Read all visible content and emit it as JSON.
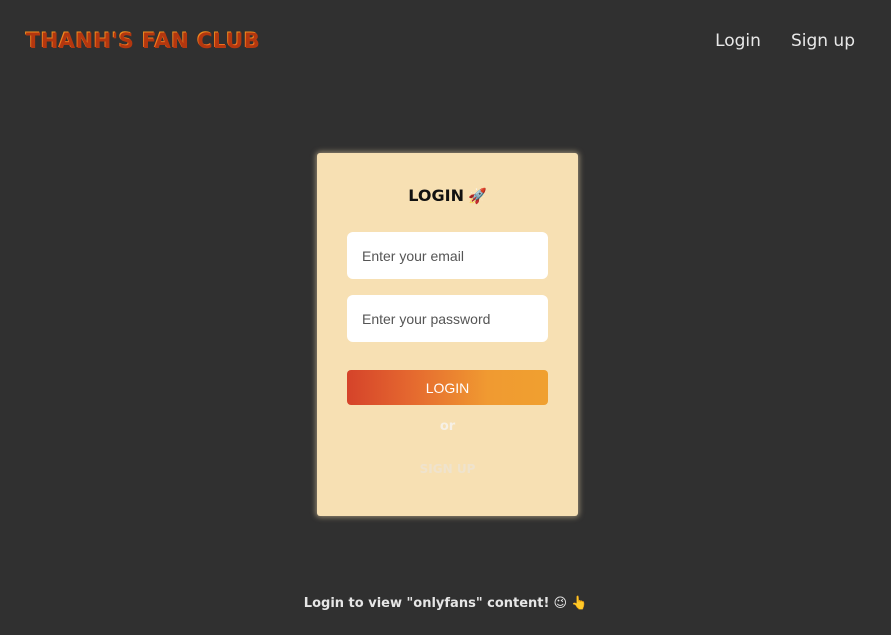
{
  "header": {
    "logo": "THANH'S FAN CLUB",
    "nav": [
      {
        "label": "Login"
      },
      {
        "label": "Sign up"
      }
    ]
  },
  "card": {
    "title": "LOGIN",
    "title_icon": "🚀",
    "email_placeholder": "Enter your email",
    "password_placeholder": "Enter your password",
    "login_button": "LOGIN",
    "or_text": "or",
    "signup_link": "SIGN UP"
  },
  "footer": {
    "note": "Login to view \"onlyfans\" content!",
    "emoji1": "😉",
    "emoji2": "👆"
  },
  "colors": {
    "background": "#303030",
    "card": "#f7e0b3",
    "accent_start": "#d5432a",
    "accent_end": "#f0a030"
  }
}
